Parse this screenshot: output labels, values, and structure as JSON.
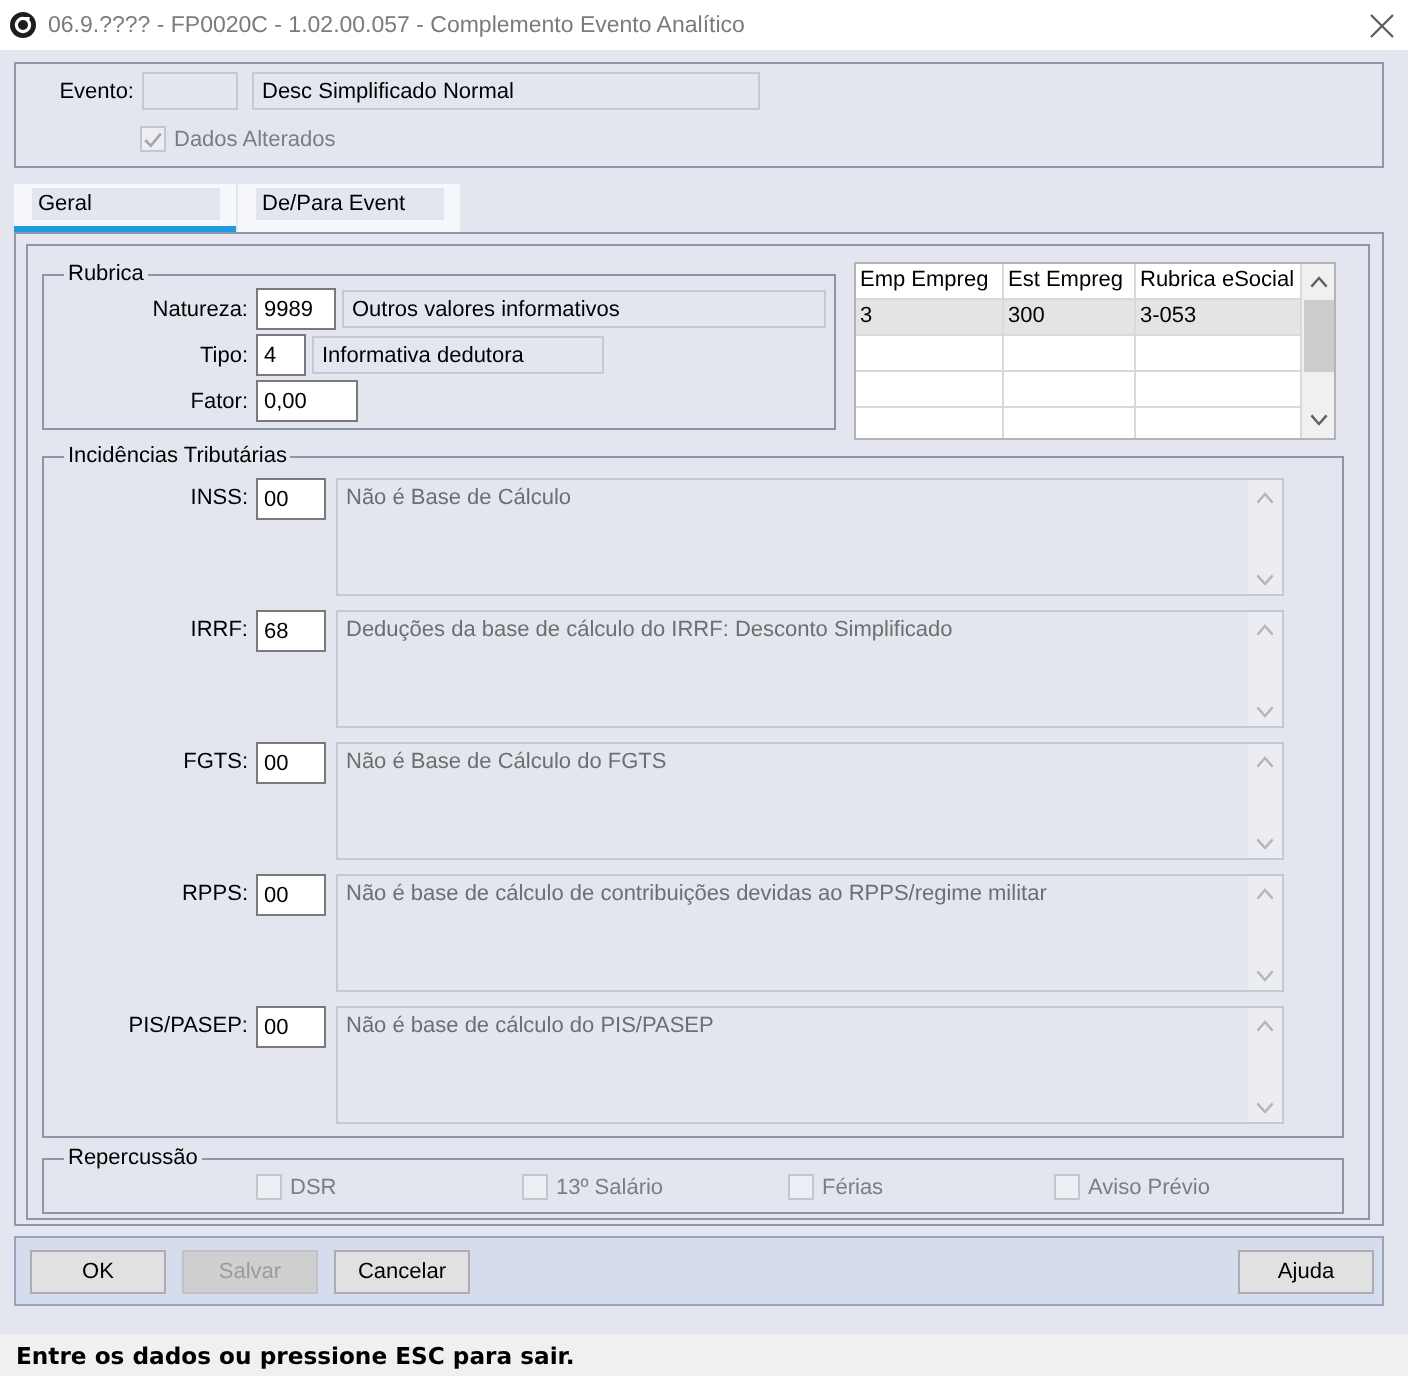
{
  "window": {
    "title": "06.9.???? - FP0020C - 1.02.00.057 - Complemento Evento Analítico"
  },
  "evento": {
    "label": "Evento:",
    "description": "Desc Simplificado Normal",
    "dados_alterados": {
      "label": "Dados Alterados",
      "checked": true,
      "disabled": true
    }
  },
  "tabs": [
    {
      "label": "Geral",
      "selected": true
    },
    {
      "label": "De/Para Event",
      "selected": false
    }
  ],
  "rubrica": {
    "title": "Rubrica",
    "fields": [
      {
        "label": "Natureza:",
        "value": "9989",
        "description": "Outros valores informativos"
      },
      {
        "label": "Tipo:",
        "value": "4",
        "description": "Informativa dedutora"
      },
      {
        "label": "Fator:",
        "value": "0,00"
      }
    ]
  },
  "rubrica_table": {
    "columns": [
      "Emp Empreg",
      "Est Empreg",
      "Rubrica eSocial"
    ],
    "rows": [
      {
        "cells": [
          "3",
          "300",
          "3-053"
        ],
        "selected": true
      }
    ]
  },
  "incidencias": {
    "title": "Incidências Tributárias",
    "items": [
      {
        "label": "INSS:",
        "code": "00",
        "description": "Não é Base de Cálculo"
      },
      {
        "label": "IRRF:",
        "code": "68",
        "description": "Deduções da base de cálculo do IRRF: Desconto Simplificado"
      },
      {
        "label": "FGTS:",
        "code": "00",
        "description": "Não é Base de Cálculo do FGTS"
      },
      {
        "label": "RPPS:",
        "code": "00",
        "description": "Não é base de cálculo de contribuições devidas ao RPPS/regime militar"
      },
      {
        "label": "PIS/PASEP:",
        "code": "00",
        "description": "Não é base de cálculo do PIS/PASEP"
      }
    ]
  },
  "repercussao": {
    "title": "Repercussão",
    "options": [
      {
        "label": "DSR",
        "checked": false,
        "disabled": true
      },
      {
        "label": "13º Salário",
        "checked": false,
        "disabled": true
      },
      {
        "label": "Férias",
        "checked": false,
        "disabled": true
      },
      {
        "label": "Aviso Prévio",
        "checked": false,
        "disabled": true
      }
    ]
  },
  "buttons": [
    {
      "label": "OK",
      "disabled": false
    },
    {
      "label": "Salvar",
      "disabled": true
    },
    {
      "label": "Cancelar",
      "disabled": false
    }
  ],
  "right_buttons": [
    {
      "label": "Ajuda",
      "disabled": false
    }
  ],
  "status_bar": {
    "text": "Entre os dados ou pressione ESC para sair."
  }
}
